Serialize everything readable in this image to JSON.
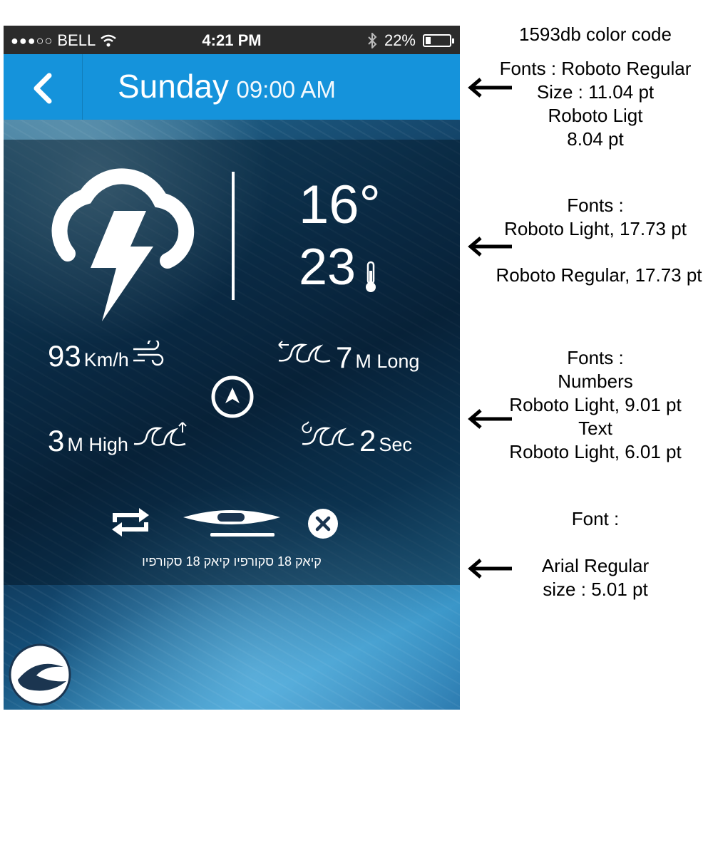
{
  "status_bar": {
    "signal": "●●●○○",
    "carrier": "BELL",
    "time": "4:21 PM",
    "battery_percent": "22%",
    "battery_level": 0.22
  },
  "header": {
    "day": "Sunday",
    "time": "09:00 AM",
    "color": "#1593db"
  },
  "weather": {
    "temp_high": "16°",
    "temp_current": "23",
    "icon": "thunderstorm-icon"
  },
  "metrics": {
    "wind_value": "93",
    "wind_unit": "Km/h",
    "wave_length_value": "7",
    "wave_length_unit": "M Long",
    "wave_height_value": "3",
    "wave_height_unit": "M High",
    "wave_period_value": "2",
    "wave_period_unit": "Sec"
  },
  "activity": {
    "caption": "קיאק 18 סקורפיו קיאק 18 סקורפיו"
  },
  "annotations": {
    "color_code": "1593db color code",
    "header_fonts": [
      "Fonts : Roboto Regular",
      "Size : 11.04 pt",
      "Roboto Ligt",
      "8.04 pt"
    ],
    "temp_fonts": [
      "Fonts :",
      "Roboto Light, 17.73 pt"
    ],
    "temp_fonts_2": "Roboto Regular, 17.73 pt",
    "metric_fonts": [
      "Fonts :",
      "Numbers",
      "Roboto Light, 9.01 pt",
      "Text",
      "Roboto Light, 6.01 pt"
    ],
    "caption_font_label": "Font :",
    "caption_font": [
      "Arial Regular",
      "size : 5.01 pt"
    ]
  }
}
